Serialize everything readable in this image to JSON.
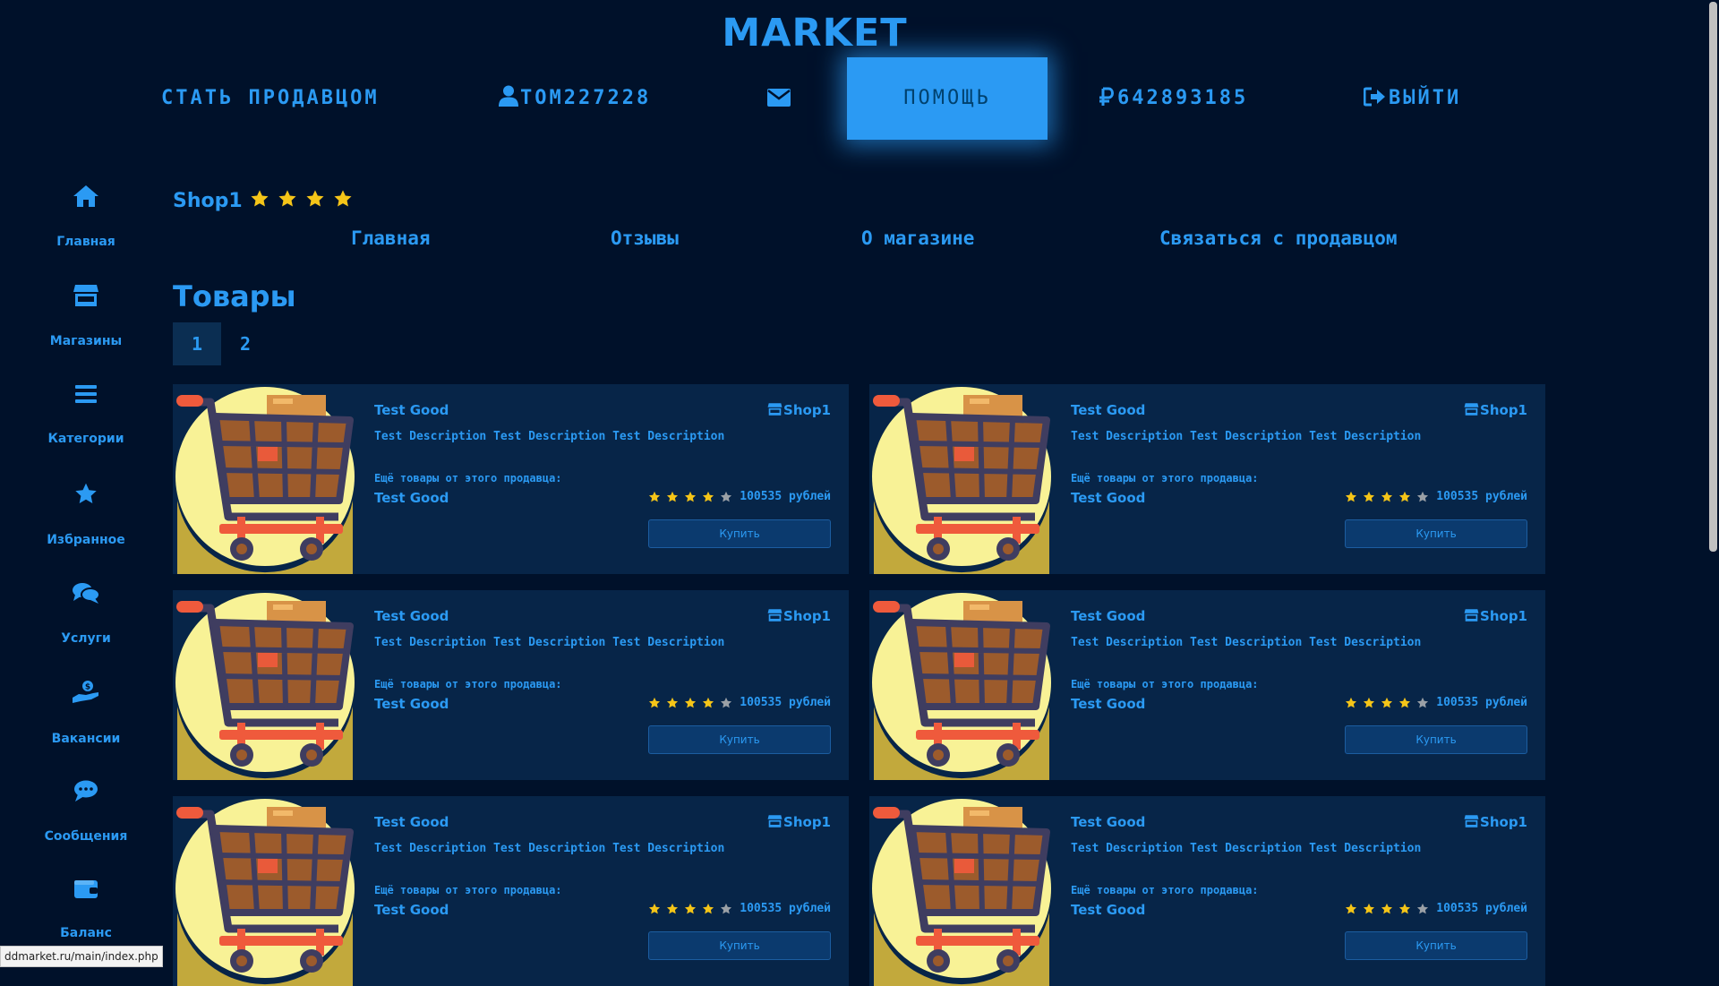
{
  "header": {
    "logo": "MARKET",
    "nav": {
      "become_seller": "СТАТЬ ПРОДАВЦОМ",
      "username": "TOM227228",
      "help": "ПОМОЩЬ",
      "balance": "642893185",
      "logout": "ВЫЙТИ"
    }
  },
  "sidebar": {
    "items": [
      {
        "label": "Главная",
        "icon": "home-icon"
      },
      {
        "label": "Магазины",
        "icon": "store-icon"
      },
      {
        "label": "Категории",
        "icon": "list-icon"
      },
      {
        "label": "Избранное",
        "icon": "star-icon"
      },
      {
        "label": "Услуги",
        "icon": "chat-bubbles-icon"
      },
      {
        "label": "Вакансии",
        "icon": "hand-money-icon"
      },
      {
        "label": "Сообщения",
        "icon": "message-icon"
      },
      {
        "label": "Баланс",
        "icon": "wallet-icon"
      }
    ]
  },
  "shop": {
    "name": "Shop1",
    "rating": 4,
    "tabs": [
      "Главная",
      "Отзывы",
      "О магазине",
      "Связаться с продавцом"
    ]
  },
  "goods": {
    "title": "Товары",
    "pages": [
      "1",
      "2"
    ],
    "active_page": "1",
    "products": [
      {
        "title": "Test Good",
        "shop": "Shop1",
        "description": "Test Description Test Description Test Description",
        "more_label": "Ещё товары от этого продавца:",
        "more_item": "Test Good",
        "rating": 4,
        "price": "100535 рублей",
        "buy": "Купить"
      },
      {
        "title": "Test Good",
        "shop": "Shop1",
        "description": "Test Description Test Description Test Description",
        "more_label": "Ещё товары от этого продавца:",
        "more_item": "Test Good",
        "rating": 4,
        "price": "100535 рублей",
        "buy": "Купить"
      },
      {
        "title": "Test Good",
        "shop": "Shop1",
        "description": "Test Description Test Description Test Description",
        "more_label": "Ещё товары от этого продавца:",
        "more_item": "Test Good",
        "rating": 4,
        "price": "100535 рублей",
        "buy": "Купить"
      },
      {
        "title": "Test Good",
        "shop": "Shop1",
        "description": "Test Description Test Description Test Description",
        "more_label": "Ещё товары от этого продавца:",
        "more_item": "Test Good",
        "rating": 4,
        "price": "100535 рублей",
        "buy": "Купить"
      },
      {
        "title": "Test Good",
        "shop": "Shop1",
        "description": "Test Description Test Description Test Description",
        "more_label": "Ещё товары от этого продавца:",
        "more_item": "Test Good",
        "rating": 4,
        "price": "100535 рублей",
        "buy": "Купить"
      },
      {
        "title": "Test Good",
        "shop": "Shop1",
        "description": "Test Description Test Description Test Description",
        "more_label": "Ещё товары от этого продавца:",
        "more_item": "Test Good",
        "rating": 4,
        "price": "100535 рублей",
        "buy": "Купить"
      }
    ]
  },
  "status_bar": {
    "url": "ddmarket.ru/main/index.php"
  },
  "colors": {
    "background": "#00112a",
    "accent": "#2b9af3",
    "card": "#072548",
    "star_on": "#f5c518",
    "star_off": "#9aa0a6"
  }
}
